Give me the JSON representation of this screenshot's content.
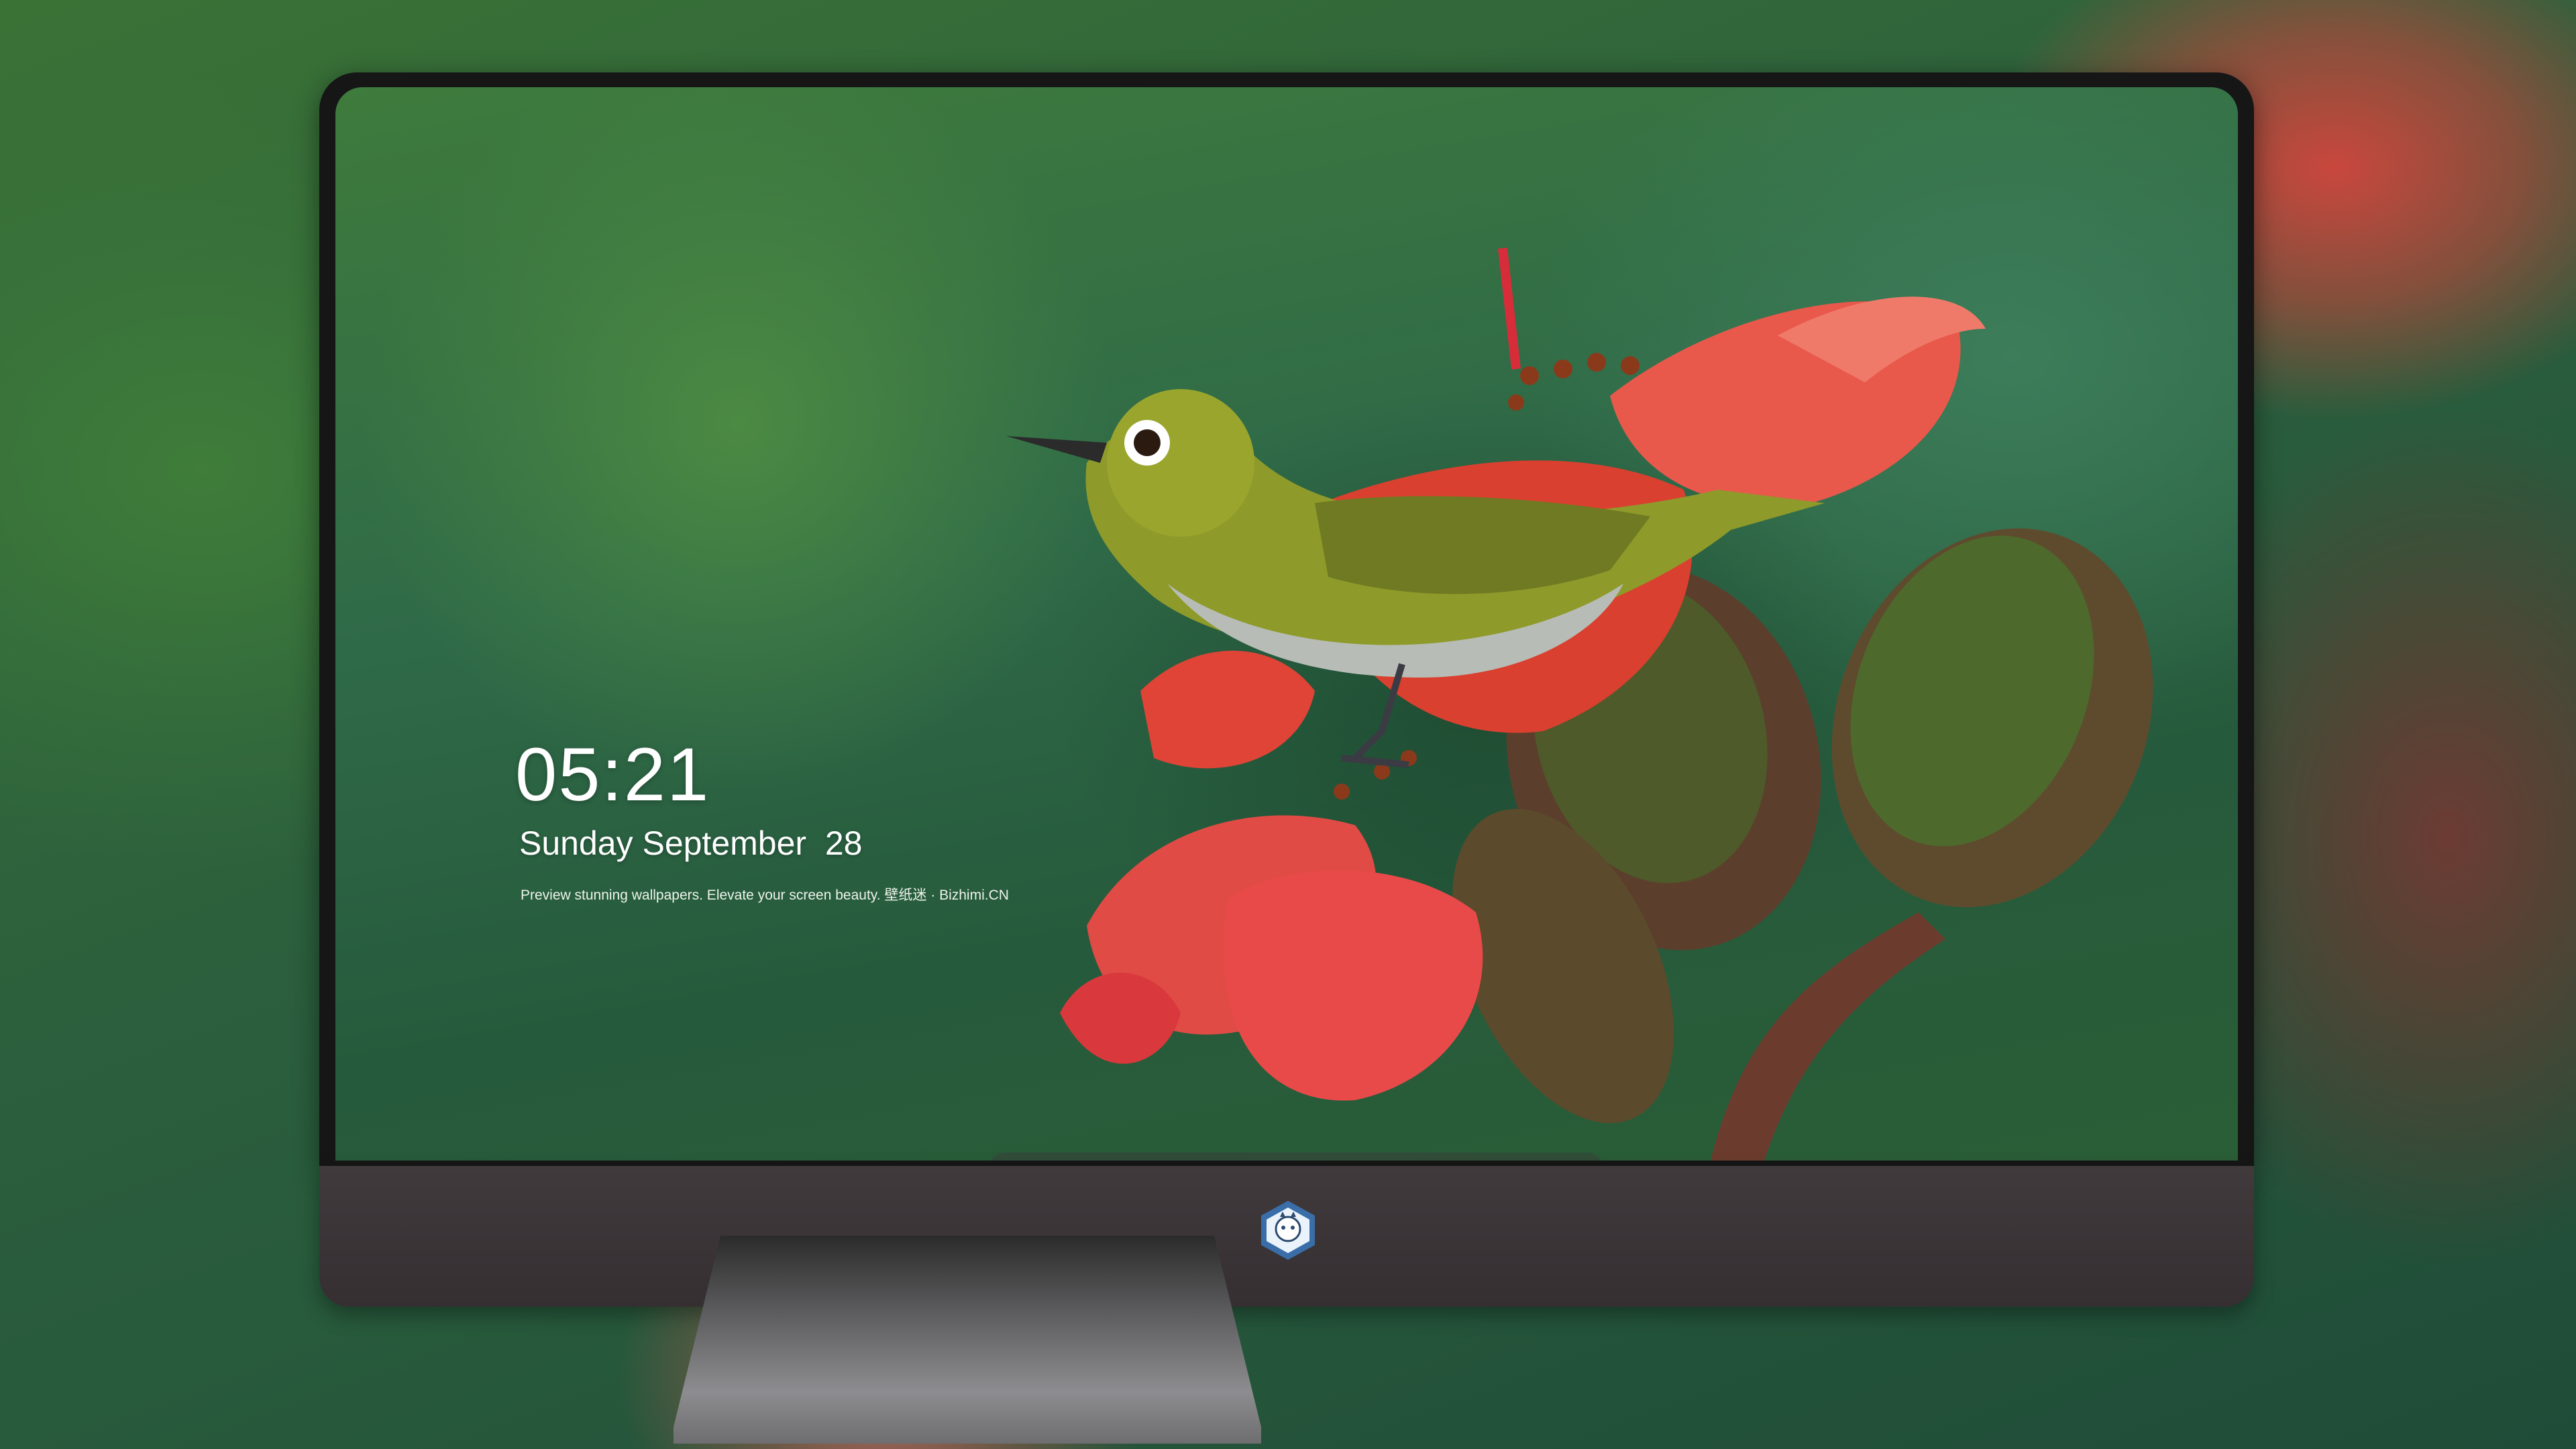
{
  "lock_screen": {
    "time": "05:21",
    "date": "Sunday September  28",
    "tagline": "Preview stunning wallpapers. Elevate your screen beauty. 壁纸迷 · Bizhimi.CN"
  },
  "dock": {
    "apps": [
      {
        "icon": "messages-icon",
        "color": "#34c759"
      },
      {
        "icon": "weather-icon",
        "color": "#2f8cf0"
      },
      {
        "icon": "clock-icon",
        "color": "#1c1c1e"
      },
      {
        "icon": "preview-icon",
        "color": "#f2c94c"
      },
      {
        "icon": "claquette-icon",
        "color": "#41c5e8"
      },
      {
        "icon": "notes-icon",
        "color": "#f7d54a"
      },
      {
        "icon": "photos-icon",
        "color": "#f0f0f0"
      }
    ],
    "pinned": [
      {
        "icon": "music-icon",
        "color": "#e64db9"
      },
      {
        "icon": "app-store-icon",
        "color": "#1a8cf5"
      },
      {
        "icon": "camera-icon",
        "color": "#8e8e93"
      }
    ]
  },
  "colors": {
    "bezel": "#161616",
    "chin": "#3b3437",
    "accent_green": "#3e7b3c",
    "flower_red": "#e8473e"
  }
}
